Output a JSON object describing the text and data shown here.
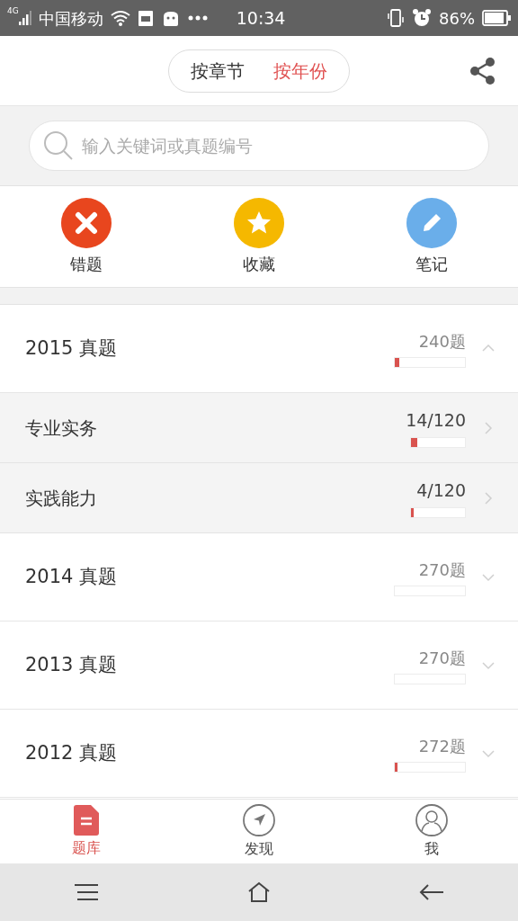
{
  "status_bar": {
    "network": "4G",
    "carrier": "中国移动",
    "time": "10:34",
    "battery": "86%"
  },
  "header": {
    "tabs": [
      {
        "label": "按章节",
        "selected": false
      },
      {
        "label": "按年份",
        "selected": true
      }
    ]
  },
  "search": {
    "placeholder": "输入关键词或真题编号"
  },
  "shortcuts": [
    {
      "label": "错题",
      "kind": "wrong",
      "color": "#e8461e"
    },
    {
      "label": "收藏",
      "kind": "star",
      "color": "#f5b800"
    },
    {
      "label": "笔记",
      "kind": "note",
      "color": "#6aaeea"
    }
  ],
  "years": [
    {
      "title": "2015 真题",
      "count": "240题",
      "level": 0.06,
      "expanded": true,
      "children": [
        {
          "title": "专业实务",
          "count": "14/120",
          "level": 0.12
        },
        {
          "title": "实践能力",
          "count": "4/120",
          "level": 0.03
        }
      ]
    },
    {
      "title": "2014 真题",
      "count": "270题",
      "level": 0,
      "expanded": false
    },
    {
      "title": "2013 真题",
      "count": "270题",
      "level": 0,
      "expanded": false
    },
    {
      "title": "2012 真题",
      "count": "272题",
      "level": 0.02,
      "expanded": false
    }
  ],
  "bottom_nav": [
    {
      "label": "题库",
      "kind": "bank",
      "selected": true
    },
    {
      "label": "发现",
      "kind": "discover",
      "selected": false
    },
    {
      "label": "我",
      "kind": "me",
      "selected": false
    }
  ]
}
